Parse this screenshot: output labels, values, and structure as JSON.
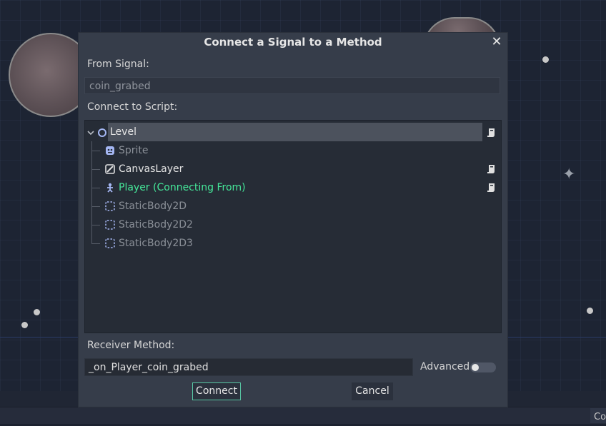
{
  "dialog": {
    "title": "Connect a Signal to a Method",
    "from_signal_label": "From Signal:",
    "from_signal_value": "coin_grabed",
    "connect_to_script_label": "Connect to Script:",
    "receiver_method_label": "Receiver Method:",
    "receiver_method_value": "_on_Player_coin_grabed",
    "advanced_label": "Advanced",
    "advanced_enabled": false,
    "connect_button": "Connect",
    "cancel_button": "Cancel"
  },
  "tree": {
    "nodes": [
      {
        "label": "Level",
        "icon": "node2d-icon",
        "has_script": true,
        "selected": true,
        "status": "normal"
      },
      {
        "label": "Sprite",
        "icon": "sprite-icon",
        "has_script": false,
        "status": "disabled"
      },
      {
        "label": "CanvasLayer",
        "icon": "canvaslayer-icon",
        "has_script": true,
        "status": "normal"
      },
      {
        "label": "Player (Connecting From)",
        "icon": "kinematic-body-icon",
        "has_script": true,
        "status": "source"
      },
      {
        "label": "StaticBody2D",
        "icon": "static-body-icon",
        "has_script": false,
        "status": "disabled"
      },
      {
        "label": "StaticBody2D2",
        "icon": "static-body-icon",
        "has_script": false,
        "status": "disabled"
      },
      {
        "label": "StaticBody2D3",
        "icon": "static-body-icon",
        "has_script": false,
        "status": "disabled"
      }
    ]
  },
  "bottom_panel": {
    "tab_label": "Co"
  },
  "colors": {
    "source_text": "#45e89a",
    "disabled_text": "#8b9098",
    "normal_text": "#e6e6e6",
    "focus_border": "#57c7a4",
    "dialog_bg": "#363d4a"
  }
}
